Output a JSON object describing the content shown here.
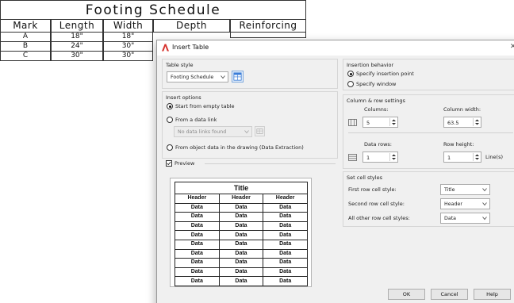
{
  "schedule": {
    "title": "Footing Schedule",
    "headers": [
      "Mark",
      "Length",
      "Width",
      "Depth",
      "Reinforcing"
    ],
    "rows": [
      [
        "A",
        "18\"",
        "18\""
      ],
      [
        "B",
        "24\"",
        "30\""
      ],
      [
        "C",
        "30\"",
        "30\""
      ]
    ]
  },
  "dialog": {
    "title": "Insert Table",
    "table_style": {
      "group_label": "Table style",
      "selected": "Footing Schedule"
    },
    "insert_options": {
      "group_label": "Insert options",
      "start_empty": "Start from empty table",
      "from_data_link": "From a data link",
      "data_link_value": "No data links found",
      "from_object_data": "From object data in the drawing (Data Extraction)"
    },
    "preview": {
      "label": "Preview",
      "checked": true,
      "title": "Title",
      "headers": [
        "Header",
        "Header",
        "Header"
      ],
      "data_cell": "Data",
      "data_rows": 9
    },
    "insertion_behavior": {
      "group_label": "Insertion behavior",
      "specify_insertion_point": "Specify insertion point",
      "specify_window": "Specify window"
    },
    "column_row": {
      "group_label": "Column & row settings",
      "columns_label": "Columns:",
      "columns_value": "5",
      "column_width_label": "Column width:",
      "column_width_value": "63.5",
      "data_rows_label": "Data rows:",
      "data_rows_value": "1",
      "row_height_label": "Row height:",
      "row_height_value": "1",
      "row_height_unit": "Line(s)"
    },
    "cell_styles": {
      "group_label": "Set cell styles",
      "first_row_label": "First row cell style:",
      "first_row_value": "Title",
      "second_row_label": "Second row cell style:",
      "second_row_value": "Header",
      "other_rows_label": "All other row cell styles:",
      "other_rows_value": "Data"
    },
    "buttons": {
      "ok": "OK",
      "cancel": "Cancel",
      "help": "Help"
    }
  },
  "colors": {
    "dialog_bg": "#f0f0f0",
    "app_icon": "#d6322d",
    "table_style_button": "#3b7dd8"
  }
}
